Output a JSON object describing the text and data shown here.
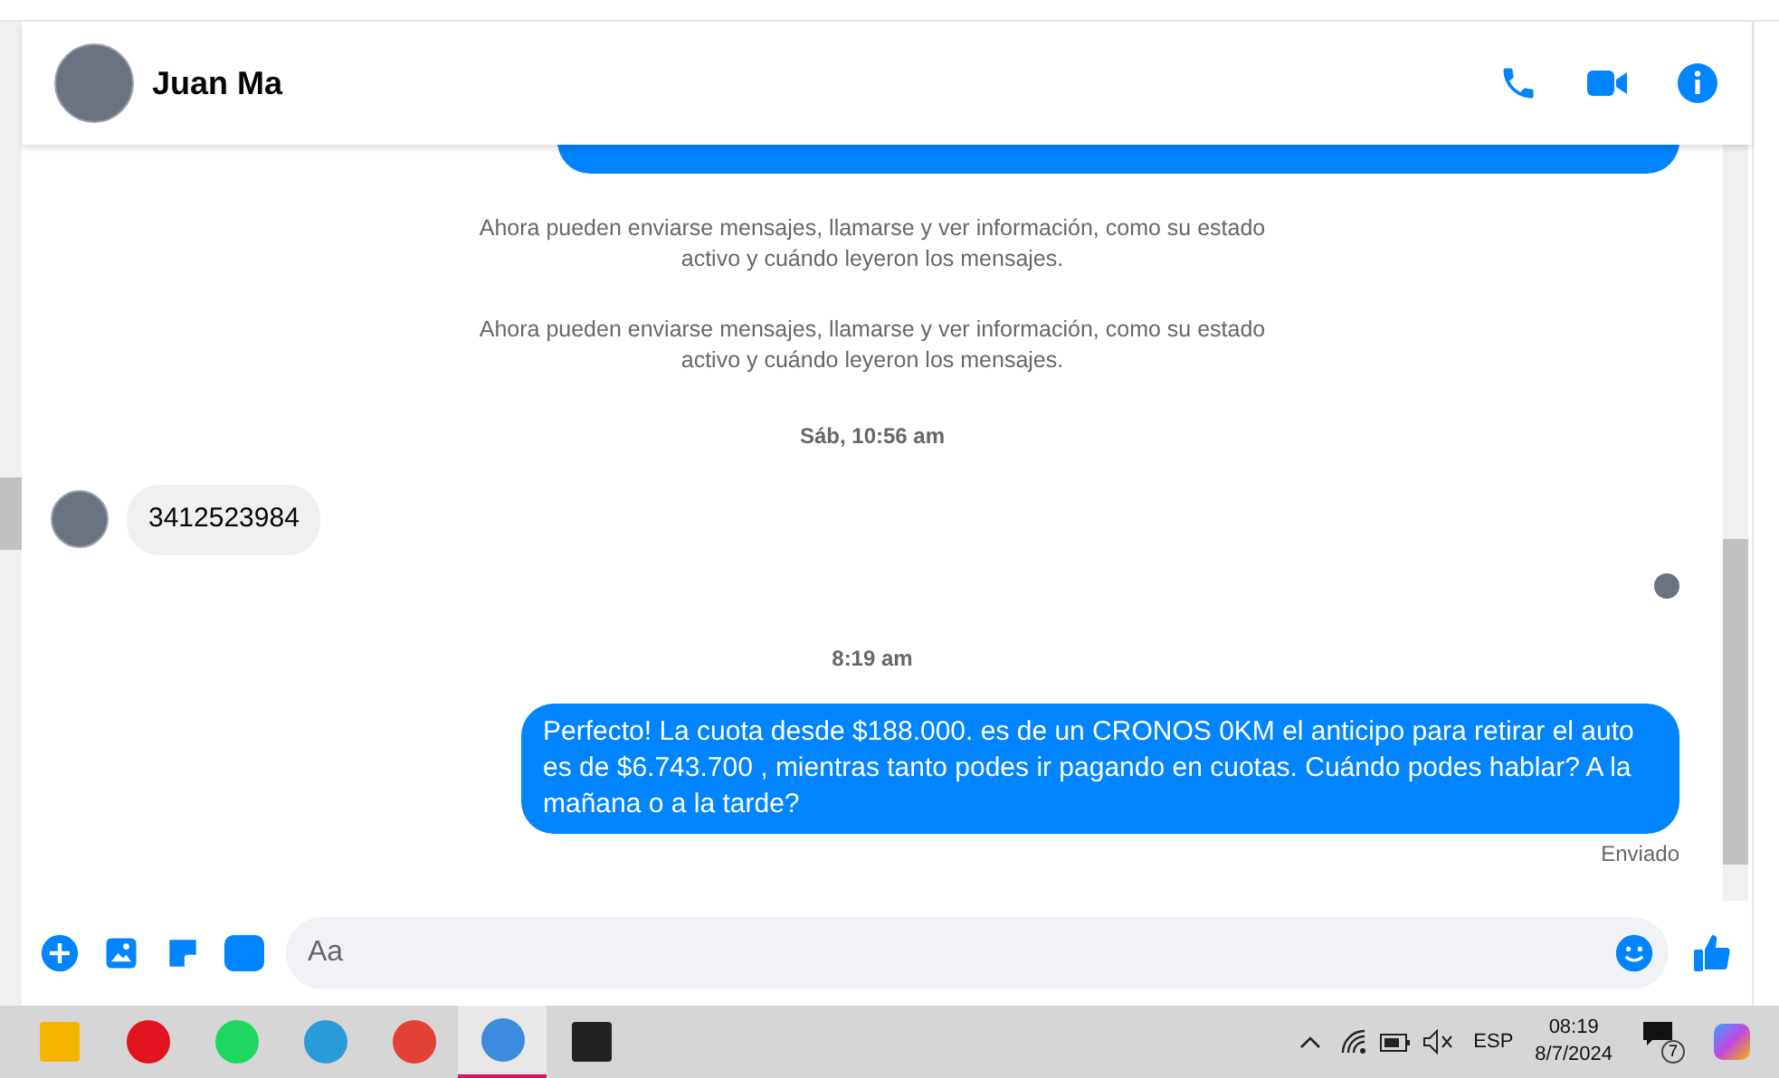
{
  "header": {
    "contact_name": "Juan Ma"
  },
  "messages": [
    {
      "kind": "outgoing-cut"
    },
    {
      "kind": "notice",
      "text": "Ahora pueden enviarse mensajes, llamarse y ver información, como su estado activo y cuándo leyeron los mensajes."
    },
    {
      "kind": "notice",
      "text": "Ahora pueden enviarse mensajes, llamarse y ver información, como su estado activo y cuándo leyeron los mensajes."
    },
    {
      "kind": "time",
      "text": "Sáb, 10:56 am"
    },
    {
      "kind": "incoming",
      "text": "3412523984"
    },
    {
      "kind": "seen"
    },
    {
      "kind": "time",
      "text": "8:19 am"
    },
    {
      "kind": "outgoing",
      "text": "Perfecto! La cuota desde $188.000. es de un CRONOS 0KM el anticipo para retirar el auto es de $6.743.700 , mientras tanto podes ir pagando en cuotas. Cuándo podes hablar? A la mañana o a la tarde?"
    },
    {
      "kind": "status",
      "text": "Enviado"
    }
  ],
  "composer": {
    "placeholder": "Aa"
  },
  "taskbar": {
    "apps": [
      {
        "kind": "folder",
        "selected": false
      },
      {
        "kind": "opera",
        "selected": false
      },
      {
        "kind": "spotify",
        "selected": false
      },
      {
        "kind": "edge",
        "selected": false
      },
      {
        "kind": "chrome",
        "selected": false
      },
      {
        "kind": "chrome-profile",
        "selected": true
      },
      {
        "kind": "sticky",
        "selected": false
      }
    ],
    "language": "ESP",
    "time": "08:19",
    "date": "8/7/2024",
    "notifications": "7"
  }
}
